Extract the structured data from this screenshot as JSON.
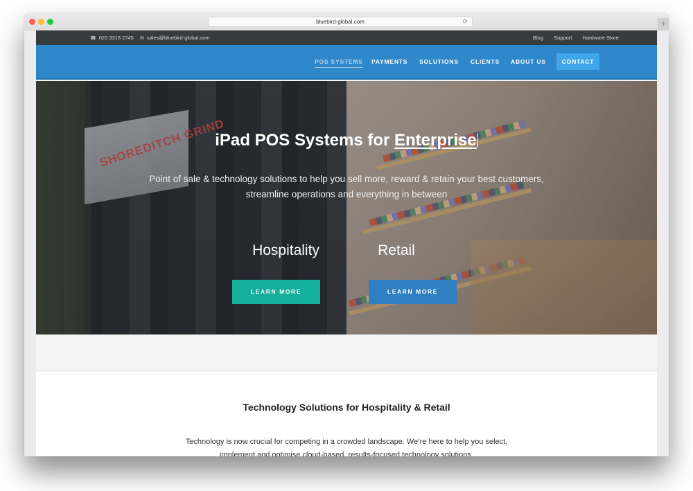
{
  "browser": {
    "url": "bluebird-global.com",
    "reload_icon": "⟳",
    "new_tab_icon": "+"
  },
  "topbar": {
    "phone_icon": "☎",
    "phone": "020 3318 2745",
    "email_icon": "✉",
    "email": "sales@bluebird-global.com",
    "links": [
      "Blog",
      "Support",
      "Hardware Store"
    ]
  },
  "nav": {
    "items": [
      {
        "label": "POS SYSTEMS",
        "active": true
      },
      {
        "label": "PAYMENTS",
        "active": false
      },
      {
        "label": "SOLUTIONS",
        "active": false
      },
      {
        "label": "CLIENTS",
        "active": false
      },
      {
        "label": "ABOUT US",
        "active": false
      }
    ],
    "contact_label": "CONTACT"
  },
  "hero": {
    "title_prefix": "iPad POS Systems for ",
    "title_highlight": "Enterprise",
    "subtitle_line1": "Point of sale & technology solutions to help you sell more, reward & retain your best customers,",
    "subtitle_line2": "streamline operations and everything in between",
    "image_sign_text": "SHOREDITCH GRIND",
    "segments": [
      {
        "title": "Hospitality",
        "button": "LEARN MORE"
      },
      {
        "title": "Retail",
        "button": "LEARN MORE"
      }
    ]
  },
  "intro": {
    "title": "Technology Solutions for Hospitality & Retail",
    "body_line1": "Technology is now crucial for competing in a crowded landscape. We’re here to help you select,",
    "body_line2": "implement and optimise cloud-based, results-focused technology solutions."
  },
  "colors": {
    "topbar": "#363b3f",
    "nav": "#2d87c8",
    "contact_button": "#41a6e9",
    "hospitality_button": "#14b09b",
    "retail_button": "#2e80c2"
  }
}
